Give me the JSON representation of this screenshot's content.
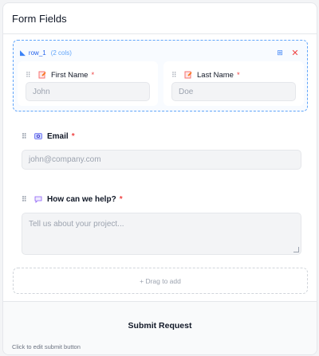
{
  "panel": {
    "title": "Form Fields"
  },
  "row": {
    "name": "row_1",
    "columns_label": "(2 cols)",
    "fields": [
      {
        "label": "First Name",
        "required_mark": "*",
        "placeholder": "John",
        "icon": "text-field-icon"
      },
      {
        "label": "Last Name",
        "required_mark": "*",
        "placeholder": "Doe",
        "icon": "text-field-icon"
      }
    ]
  },
  "email": {
    "label": "Email",
    "required_mark": "*",
    "placeholder": "john@company.com",
    "icon": "email-field-icon"
  },
  "message": {
    "label": "How can we help?",
    "required_mark": "*",
    "placeholder": "Tell us about your project...",
    "icon": "chat-bubble-icon"
  },
  "dropzone": {
    "label": "+ Drag to add"
  },
  "footer": {
    "submit_label": "Submit Request",
    "hint": "Click to edit submit button"
  },
  "colors": {
    "accent": "#3b82f6",
    "required": "#ef4444"
  }
}
